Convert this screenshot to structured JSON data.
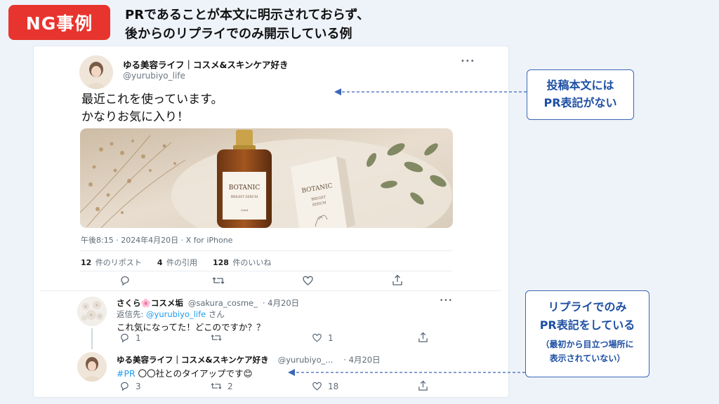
{
  "header": {
    "badge": "NG事例",
    "line1": "PRであることが本文に明示されておらず、",
    "line2": "後からのリプライでのみ開示している例"
  },
  "tweet": {
    "name": "ゆる美容ライフ｜コスメ&スキンケア好き",
    "handle": "@yurubiyo_life",
    "more": "•••",
    "text_line1": "最近これを使っています。",
    "text_line2": "かなりお気に入り！",
    "meta": "午後8:15 · 2024年4月20日 · X for iPhone",
    "stats": {
      "reposts_count": "12",
      "reposts_label": "件のリポスト",
      "quotes_count": "4",
      "quotes_label": "件の引用",
      "likes_count": "128",
      "likes_label": "件のいいね"
    },
    "product": {
      "bottle_brand": "BOTANIC",
      "bottle_sub1": "BRIGHT SERUM",
      "bottle_sub2": "30ml",
      "box_brand": "BOTANIC",
      "box_sub1": "BRIGHT",
      "box_sub2": "SERUM"
    }
  },
  "reply1": {
    "name": "さくら🌸コスメ垢",
    "handle": "@sakura_cosme_",
    "date": "· 4月20日",
    "reply_to_prefix": "返信先: ",
    "reply_to_handle": "@yurubiyo_life",
    "reply_to_suffix": " さん",
    "text": "これ気になってた！どこのですか？？",
    "more": "•••",
    "reply_count": "1",
    "like_count": "1"
  },
  "reply2": {
    "name": "ゆる美容ライフ｜コスメ&スキンケア好き",
    "handle": "@yurubiyo_...",
    "date": "· 4月20日",
    "hashtag": "#PR",
    "text": " 〇〇社とのタイアップです😊",
    "reply_count": "3",
    "repost_count": "2",
    "like_count": "18"
  },
  "callouts": {
    "top_line1": "投稿本文には",
    "top_line2": "PR表記がない",
    "bottom_line1": "リプライでのみ",
    "bottom_line2": "PR表記をしている",
    "bottom_note1": "（最初から目立つ場所に",
    "bottom_note2": "表示されていない）"
  },
  "colors": {
    "badge": "#e8342e",
    "callout_border": "#3a66b8",
    "callout_text": "#1d4fa3",
    "link": "#1d9bf0"
  }
}
